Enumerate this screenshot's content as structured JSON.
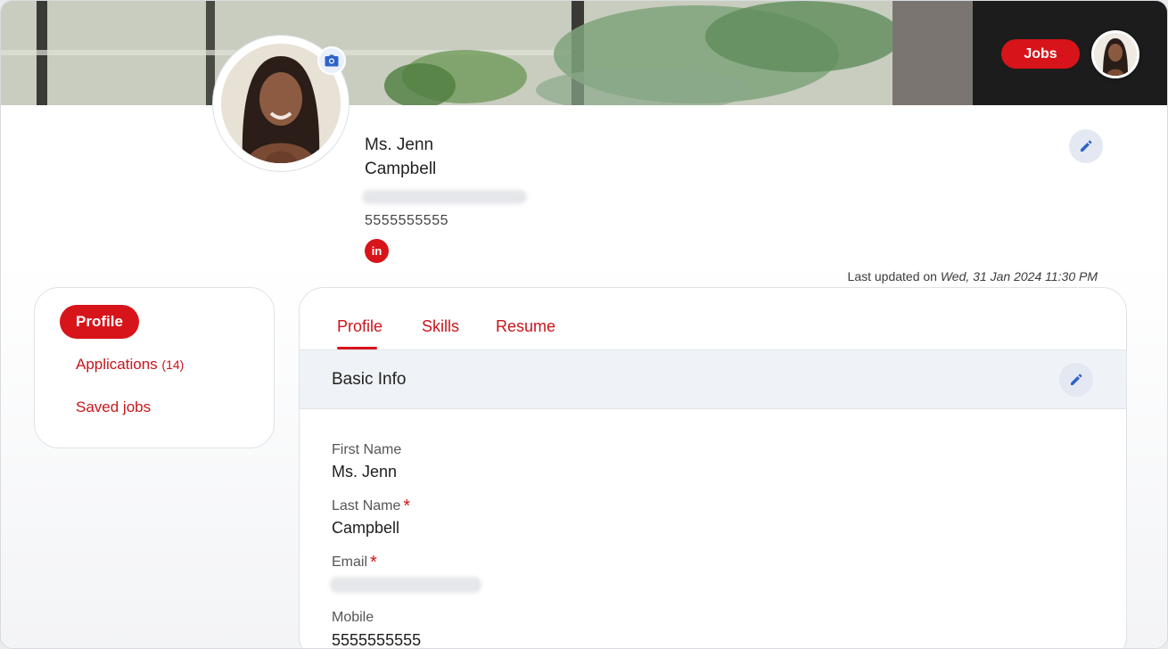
{
  "header": {
    "jobs_label": "Jobs"
  },
  "profile": {
    "name_line1": "Ms. Jenn",
    "name_line2": "Campbell",
    "phone": "5555555555",
    "linkedin_label": "in",
    "last_updated_prefix": "Last updated on",
    "last_updated_value": "Wed, 31 Jan 2024 11:30 PM"
  },
  "sidebar": {
    "items": [
      {
        "label": "Profile"
      },
      {
        "label": "Applications",
        "count": "(14)"
      },
      {
        "label": "Saved jobs"
      }
    ]
  },
  "tabs": [
    {
      "label": "Profile"
    },
    {
      "label": "Skills"
    },
    {
      "label": "Resume"
    }
  ],
  "section": {
    "title": "Basic Info",
    "fields": [
      {
        "label": "First Name",
        "value": "Ms. Jenn"
      },
      {
        "label": "Last Name",
        "value": "Campbell",
        "required": "*"
      },
      {
        "label": "Email",
        "required": "*"
      },
      {
        "label": "Mobile",
        "value": "5555555555"
      }
    ]
  },
  "colors": {
    "accent": "#d7141a",
    "edit_bg": "#e3e8f2",
    "edit_icon": "#2f63c9"
  },
  "icons": [
    "camera-icon",
    "pencil-icon",
    "linkedin-icon"
  ]
}
